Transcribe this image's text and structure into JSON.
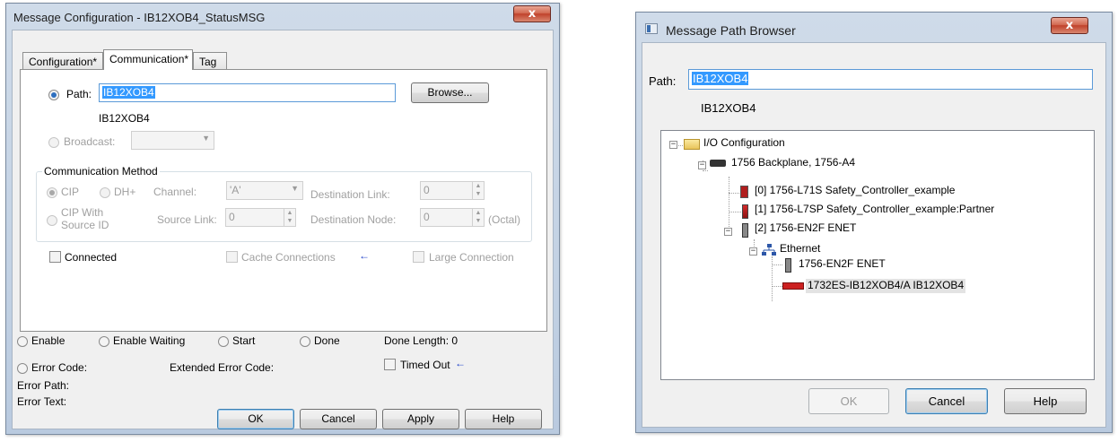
{
  "left_dialog": {
    "title": "Message Configuration - IB12XOB4_StatusMSG",
    "close_label": "x",
    "tabs": [
      "Configuration*",
      "Communication*",
      "Tag"
    ],
    "path_label": "Path:",
    "path_value": "IB12XOB4",
    "path_resolved": "IB12XOB4",
    "browse_label": "Browse...",
    "broadcast_label": "Broadcast:",
    "comm_method_title": "Communication Method",
    "cip_label": "CIP",
    "dhplus_label": "DH+",
    "channel_label": "Channel:",
    "channel_value": "'A'",
    "dest_link_label": "Destination Link:",
    "dest_link_value": "0",
    "cip_source_label_1": "CIP With",
    "cip_source_label_2": "Source ID",
    "source_link_label": "Source Link:",
    "source_link_value": "0",
    "dest_node_label": "Destination Node:",
    "dest_node_value": "0",
    "octal_label": "(Octal)",
    "connected_label": "Connected",
    "cache_label": "Cache Connections",
    "cache_arrow": "←",
    "large_conn_label": "Large Connection",
    "status": {
      "enable": "Enable",
      "enable_waiting": "Enable Waiting",
      "start": "Start",
      "done": "Done",
      "done_length": "Done Length: 0",
      "error_code": "Error Code:",
      "extended_error": "Extended Error Code:",
      "timed_out": "Timed Out",
      "timed_out_arrow": "←",
      "error_path": "Error Path:",
      "error_text": "Error Text:"
    },
    "buttons": {
      "ok": "OK",
      "cancel": "Cancel",
      "apply": "Apply",
      "help": "Help"
    }
  },
  "right_dialog": {
    "title": "Message Path Browser",
    "close_label": "x",
    "path_label": "Path:",
    "path_value": "IB12XOB4",
    "path_resolved": "IB12XOB4",
    "tree": [
      "I/O Configuration",
      "1756 Backplane, 1756-A4",
      "[0] 1756-L71S Safety_Controller_example",
      "[1] 1756-L7SP Safety_Controller_example:Partner",
      "[2] 1756-EN2F ENET",
      "Ethernet",
      "1756-EN2F ENET",
      "1732ES-IB12XOB4/A IB12XOB4"
    ],
    "buttons": {
      "ok": "OK",
      "cancel": "Cancel",
      "help": "Help"
    }
  },
  "colors": {
    "selection": "#3399ff",
    "arrow": "#1c3fc9",
    "close": "#c0422b"
  }
}
